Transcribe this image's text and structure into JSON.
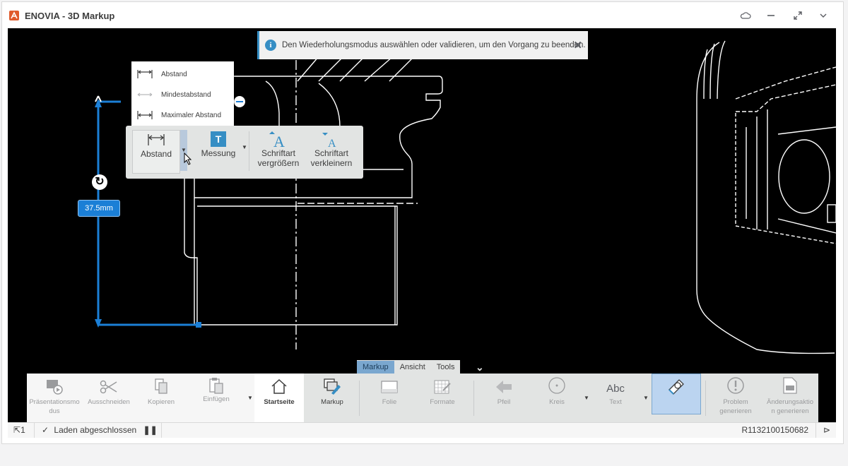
{
  "window": {
    "title": "ENOVIA - 3D Markup"
  },
  "notification": {
    "text": "Den Wiederholungsmodus auswählen oder validieren, um den Vorgang zu beenden.",
    "icon": "info-icon"
  },
  "distance_menu": {
    "items": [
      {
        "label": "Abstand",
        "icon": "distance-icon"
      },
      {
        "label": "Mindestabstand",
        "icon": "minimum-distance-icon"
      },
      {
        "label": "Maximaler Abstand",
        "icon": "maximum-distance-icon"
      }
    ]
  },
  "context_toolbar": {
    "abstand": "Abstand",
    "messung": "Messung",
    "messung_icon_text": "T",
    "grow_line1": "Schriftart",
    "grow_line2": "vergrößern",
    "shrink_line1": "Schriftart",
    "shrink_line2": "verkleinern"
  },
  "dimension": {
    "label": "37.5mm"
  },
  "tabs": [
    {
      "label": "Markup",
      "active": true
    },
    {
      "label": "Ansicht",
      "active": false
    },
    {
      "label": "Tools",
      "active": false
    }
  ],
  "bottom_toolbar": {
    "praesentation_line1": "Präsentationsmo",
    "praesentation_line2": "dus",
    "ausschneiden": "Ausschneiden",
    "kopieren": "Kopieren",
    "einfuegen": "Einfügen",
    "startseite": "Startseite",
    "markup": "Markup",
    "folie": "Folie",
    "formate": "Formate",
    "pfeil": "Pfeil",
    "kreis": "Kreis",
    "text": "Text",
    "text_icon_text": "Abc",
    "problem_line1": "Problem",
    "problem_line2": "generieren",
    "aenderung_line1": "Änderungsaktio",
    "aenderung_line2": "n generieren"
  },
  "status": {
    "selection_count": "1",
    "load_status": "Laden abgeschlossen",
    "revision": "R1132100150682"
  },
  "colors": {
    "accent": "#368ec4",
    "selection_blue": "#1b7fd6",
    "viewport_bg": "#000000",
    "toolbar_bg": "#e2e4e3"
  }
}
